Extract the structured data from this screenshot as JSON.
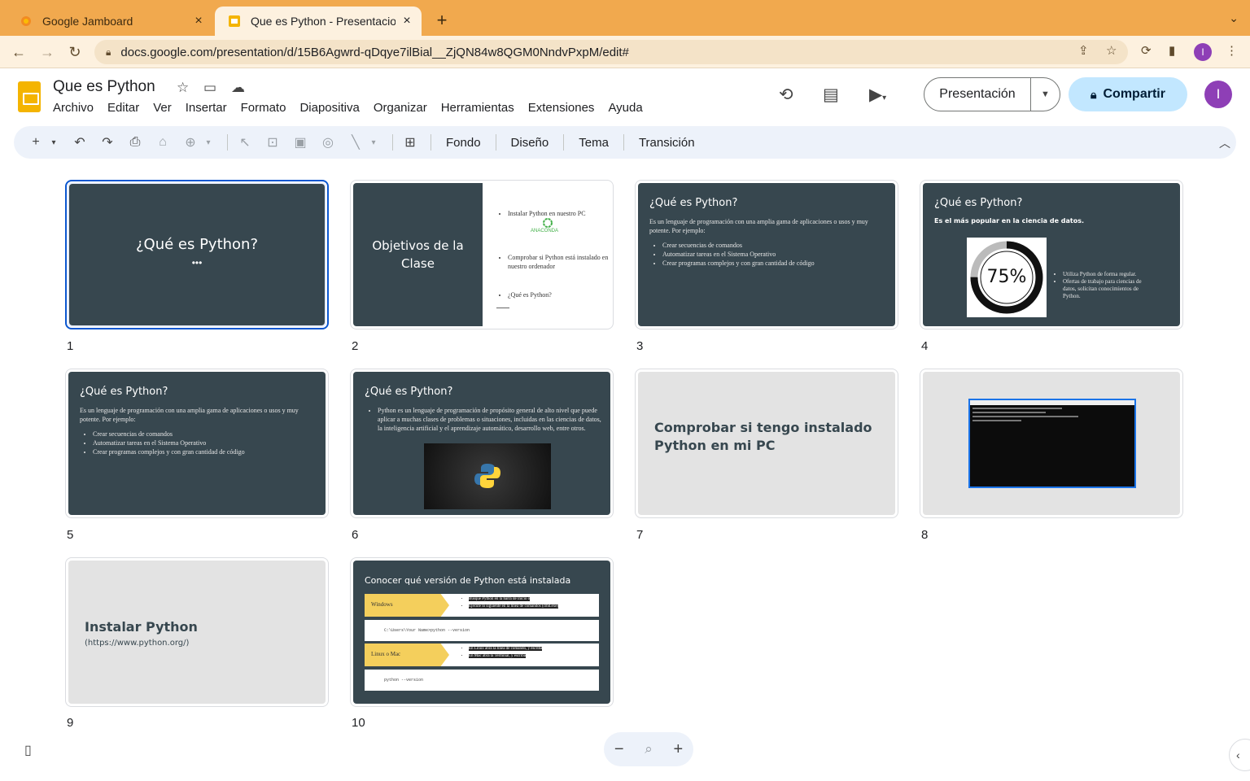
{
  "browser": {
    "tabs": [
      {
        "title": "Google Jamboard",
        "active": false
      },
      {
        "title": "Que es Python - Presentaciones",
        "active": true
      }
    ],
    "url": "docs.google.com/presentation/d/15B6Agwrd-qDqye7ilBial__ZjQN84w8QGM0NndvPxpM/edit#",
    "profile_initial": "I"
  },
  "app": {
    "title": "Que es Python",
    "menu": [
      "Archivo",
      "Editar",
      "Ver",
      "Insertar",
      "Formato",
      "Diapositiva",
      "Organizar",
      "Herramientas",
      "Extensiones",
      "Ayuda"
    ],
    "present_label": "Presentación",
    "share_label": "Compartir",
    "avatar_initial": "I"
  },
  "toolbar": {
    "text_buttons": [
      "Fondo",
      "Diseño",
      "Tema",
      "Transición"
    ]
  },
  "slides": [
    {
      "num": "1",
      "title": "¿Qué es Python?",
      "dots": "•••"
    },
    {
      "num": "2",
      "title": "Objetivos de la Clase",
      "items": [
        "Instalar Python en nuestro PC",
        "Comprobar si Python está instalado en nuestro ordenador",
        "¿Qué es Python?"
      ],
      "logo_text": "ANACONDA"
    },
    {
      "num": "3",
      "title": "¿Qué es Python?",
      "intro": "Es un lenguaje de programación con una amplia gama de aplicaciones o usos y muy potente. Por ejemplo:",
      "items": [
        "Crear secuencias de comandos",
        "Automatizar tareas en el Sistema Operativo",
        "Crear programas complejos y con gran cantidad de código"
      ]
    },
    {
      "num": "4",
      "title": "¿Qué es Python?",
      "subtitle": "Es el más popular en la ciencia de datos.",
      "percent": "75%",
      "percent_value": 75,
      "items": [
        "Utiliza Python de forma regular.",
        "Ofertas de trabajo para ciencias de datos, solicitan conocimientos de Python."
      ]
    },
    {
      "num": "5",
      "title": "¿Qué es Python?",
      "intro": "Es un lenguaje de programación con una amplia gama de aplicaciones o usos y muy potente. Por ejemplo:",
      "items": [
        "Crear secuencias de comandos",
        "Automatizar tareas en el Sistema Operativo",
        "Crear programas complejos y con gran cantidad de código"
      ]
    },
    {
      "num": "6",
      "title": "¿Qué es Python?",
      "items": [
        "Python es un lenguaje de programación de propósito general de alto nivel que puede aplicar a muchas clases de problemas o situaciones, incluidas en las ciencias de datos, la inteligencia artificial y el aprendizaje automático, desarrollo web, entre otros."
      ]
    },
    {
      "num": "7",
      "title": "Comprobar si tengo instalado Python en mi PC"
    },
    {
      "num": "8"
    },
    {
      "num": "9",
      "title": "Instalar Python",
      "subtitle": "(https://www.python.org/)"
    },
    {
      "num": "10",
      "title": "Conocer qué versión de Python está instalada",
      "rows": [
        {
          "label": "Windows",
          "items": [
            "Busque Python en la barra de inicio o",
            "Ejecute lo siguiente en la línea de comandos (cmd.exe)"
          ]
        },
        {
          "code": "C:\\Users\\Your Name>python --version"
        },
        {
          "label": "Linux o Mac",
          "items": [
            "En Linux abra la línea de comando, y escriba",
            "En Mac abra la Terminal, y escriba"
          ]
        },
        {
          "code": "python --version"
        }
      ]
    }
  ],
  "colors": {
    "slide_dark": "#37474f",
    "slide_light": "#e3e3e3",
    "accent": "#0b57d0",
    "share_bg": "#c2e7ff",
    "tab_strip": "#f1a94e",
    "callout_yellow": "#f4cf5c"
  },
  "icons": [
    "search-icon",
    "star-icon",
    "folder-icon",
    "cloud-icon",
    "history-icon",
    "comment-icon",
    "camera-icon",
    "lock-icon"
  ]
}
